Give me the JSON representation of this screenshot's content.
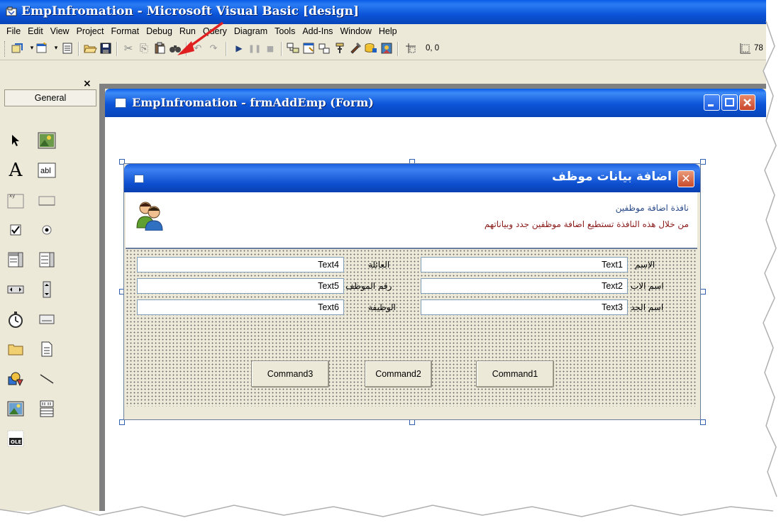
{
  "window": {
    "title": "EmpInfromation - Microsoft Visual Basic [design]"
  },
  "menu": [
    "File",
    "Edit",
    "View",
    "Project",
    "Format",
    "Debug",
    "Run",
    "Query",
    "Diagram",
    "Tools",
    "Add-Ins",
    "Window",
    "Help"
  ],
  "toolbar": {
    "coords": "0, 0",
    "size_partial": "78"
  },
  "toolbox": {
    "general_label": "General",
    "close_glyph": "×"
  },
  "form_window": {
    "title": "EmpInfromation - frmAddEmp (Form)"
  },
  "dialog": {
    "title": "اضافة بيانات موظف",
    "close_glyph": "✕",
    "header_line1": "نافذة اضافة موظفين",
    "header_line2": "من خلال هذه النافذة تستطيع اضافة موظفين جدد وبياناتهم"
  },
  "fields": [
    {
      "label": "الاسم",
      "value": "Text1"
    },
    {
      "label": "اسم الاب",
      "value": "Text2"
    },
    {
      "label": "اسم الجد",
      "value": "Text3"
    },
    {
      "label": "العائلة",
      "value": "Text4"
    },
    {
      "label": "رقم الموظف",
      "value": "Text5"
    },
    {
      "label": "الوظيفة",
      "value": "Text6"
    }
  ],
  "buttons": [
    "Command1",
    "Command2",
    "Command3"
  ],
  "colors": {
    "titlebar_blue": "#0b54d8",
    "header_line1": "#2a4a8a",
    "header_line2": "#8a1a1a",
    "arrow": "#e02020"
  }
}
